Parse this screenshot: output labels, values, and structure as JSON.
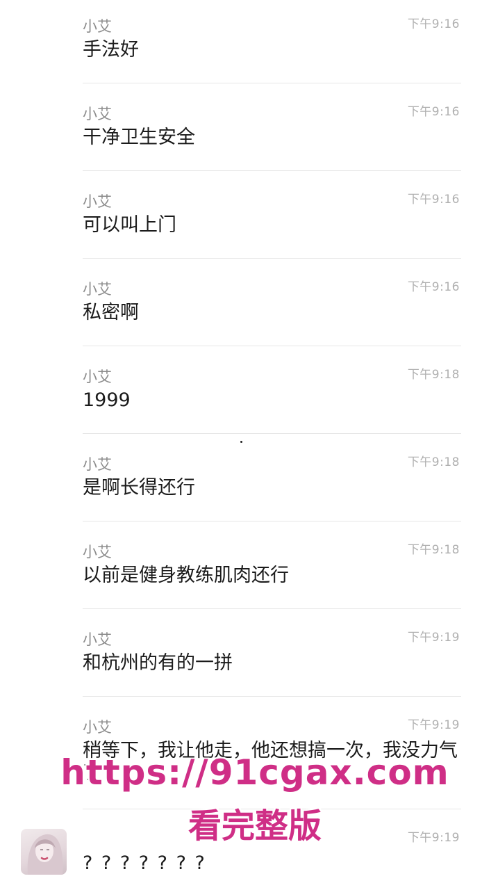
{
  "messages": [
    {
      "sender": "小艾",
      "time": "下午9:16",
      "text": "手法好"
    },
    {
      "sender": "小艾",
      "time": "下午9:16",
      "text": "干净卫生安全"
    },
    {
      "sender": "小艾",
      "time": "下午9:16",
      "text": "可以叫上门"
    },
    {
      "sender": "小艾",
      "time": "下午9:16",
      "text": "私密啊"
    },
    {
      "sender": "小艾",
      "time": "下午9:18",
      "text": "1999"
    },
    {
      "sender": "小艾",
      "time": "下午9:18",
      "text": "是啊长得还行"
    },
    {
      "sender": "小艾",
      "time": "下午9:18",
      "text": "以前是健身教练肌肉还行"
    },
    {
      "sender": "小艾",
      "time": "下午9:19",
      "text": "和杭州的有的一拼"
    },
    {
      "sender": "小艾",
      "time": "下午9:19",
      "text": "稍等下，我让他走，他还想搞一次，我没力气了"
    },
    {
      "sender": "",
      "time": "下午9:19",
      "text": "? ? ? ? ? ? ?"
    }
  ],
  "watermark": {
    "url": "https://91cgax.com",
    "caption": "看完整版"
  }
}
